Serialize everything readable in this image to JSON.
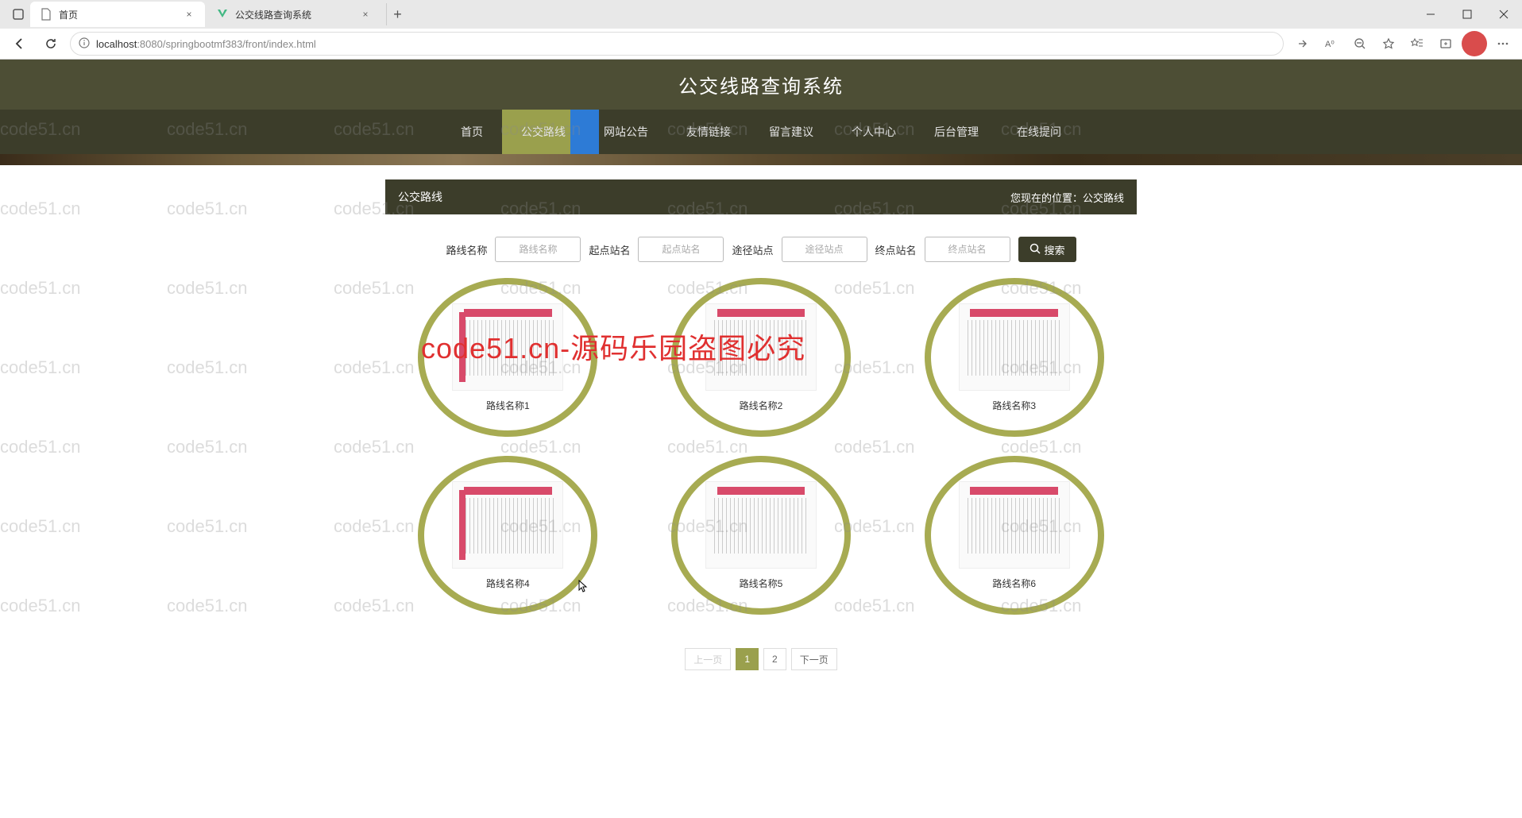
{
  "browser": {
    "tabs": [
      {
        "title": "首页",
        "active": true,
        "favicon": "page"
      },
      {
        "title": "公交线路查询系统",
        "active": false,
        "favicon": "vue"
      }
    ],
    "url_host": "localhost",
    "url_port": ":8080",
    "url_path": "/springbootmf383/front/index.html"
  },
  "site": {
    "title": "公交线路查询系统",
    "nav": [
      "首页",
      "公交路线",
      "网站公告",
      "友情链接",
      "留言建议",
      "个人中心",
      "后台管理",
      "在线提问"
    ],
    "nav_active_index": 1
  },
  "crumb": {
    "section": "公交路线",
    "location_label": "您现在的位置：",
    "location_value": "公交路线"
  },
  "search": {
    "fields": [
      {
        "label": "路线名称",
        "placeholder": "路线名称"
      },
      {
        "label": "起点站名",
        "placeholder": "起点站名"
      },
      {
        "label": "途径站点",
        "placeholder": "途径站点"
      },
      {
        "label": "终点站名",
        "placeholder": "终点站名"
      }
    ],
    "button": "搜索"
  },
  "cards": [
    {
      "label": "路线名称1"
    },
    {
      "label": "路线名称2"
    },
    {
      "label": "路线名称3"
    },
    {
      "label": "路线名称4"
    },
    {
      "label": "路线名称5"
    },
    {
      "label": "路线名称6"
    }
  ],
  "pagination": {
    "prev": "上一页",
    "pages": [
      "1",
      "2"
    ],
    "next": "下一页",
    "active_index": 0
  },
  "watermark": {
    "text": "code51.cn",
    "red": "code51.cn-源码乐园盗图必究"
  }
}
